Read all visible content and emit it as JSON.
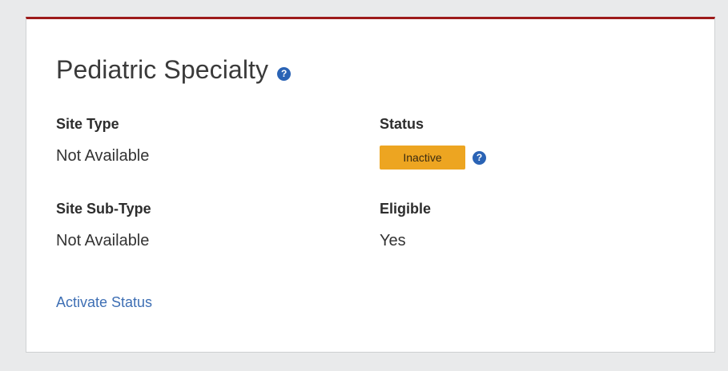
{
  "card": {
    "title": "Pediatric Specialty",
    "help_glyph": "?",
    "accent_color": "#9d1b1b"
  },
  "fields": {
    "site_type": {
      "label": "Site Type",
      "value": "Not Available"
    },
    "status": {
      "label": "Status",
      "badge": "Inactive",
      "badge_color": "#eda521"
    },
    "site_sub_type": {
      "label": "Site Sub-Type",
      "value": "Not Available"
    },
    "eligible": {
      "label": "Eligible",
      "value": "Yes"
    }
  },
  "actions": {
    "activate_status": "Activate Status"
  },
  "icons": {
    "title_help": "help-icon",
    "status_help": "help-icon"
  }
}
